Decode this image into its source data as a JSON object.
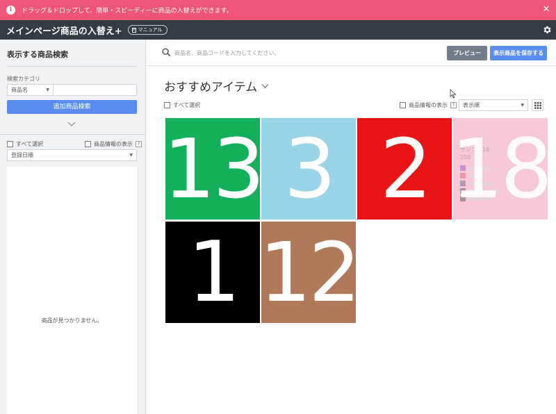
{
  "notice": {
    "text": "ドラッグ＆ドロップして、簡単・スピーディーに商品の入替えができます。"
  },
  "header": {
    "title": "メインページ商品の入替え+",
    "manual_label": "マニュアル"
  },
  "sidebar": {
    "title": "表示する商品検索",
    "category_label": "検索カテゴリ",
    "category_select": "商品名",
    "search_button": "追加商品検索",
    "select_all": "すべて選択",
    "show_info": "商品情報の表示",
    "help": "?",
    "sort": "登録日順",
    "empty": "商品が見つかりません。"
  },
  "main": {
    "search_placeholder": "商品名、商品コードを入力してください。",
    "preview_button": "プレビュー",
    "save_button": "表示商品を保存する",
    "section_title": "おすすめアイテム",
    "select_all": "すべて選択",
    "show_info": "商品情報の表示",
    "help": "?",
    "sort": "表示順",
    "products": [
      {
        "label": "13",
        "color": "#12b05a"
      },
      {
        "label": "3",
        "color": "#99d4e8"
      },
      {
        "label": "2",
        "color": "#e81416"
      },
      {
        "label": "18",
        "color": "#f7c8d8"
      },
      {
        "label": "1",
        "color": "#000000"
      },
      {
        "label": "12",
        "color": "#b07a5a"
      }
    ],
    "overlay": {
      "name": "サンプル18",
      "price": "250"
    }
  },
  "colors": {
    "notice": "#ee5577",
    "header": "#343b44",
    "primary": "#5a8cf0",
    "secondary": "#727d8c"
  }
}
